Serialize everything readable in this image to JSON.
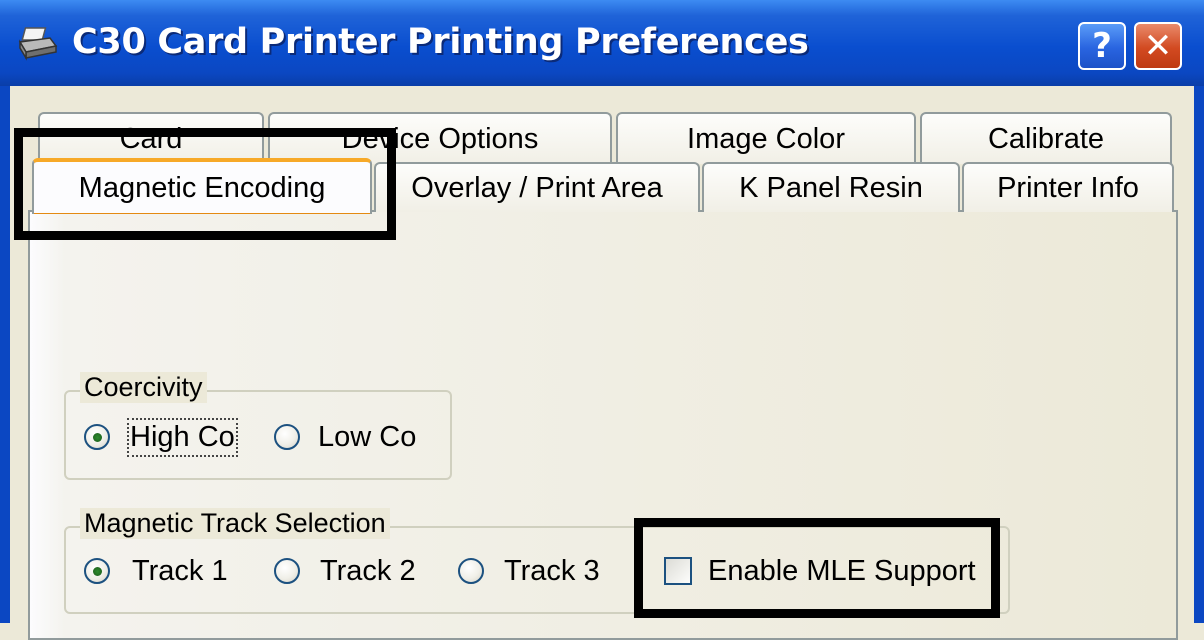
{
  "window": {
    "title": "C30 Card Printer Printing Preferences",
    "help_label": "?",
    "close_label": "✕"
  },
  "tabs_row1": [
    "Card",
    "Device Options",
    "Image Color",
    "Calibrate"
  ],
  "tabs_row2": [
    "Magnetic Encoding",
    "Overlay / Print Area",
    "K Panel Resin",
    "Printer Info"
  ],
  "active_tab": "Magnetic Encoding",
  "coercivity": {
    "label": "Coercivity",
    "options": [
      "High Co",
      "Low Co"
    ],
    "selected": "High Co"
  },
  "track_selection": {
    "label": "Magnetic Track Selection",
    "options": [
      "Track 1",
      "Track 2",
      "Track 3"
    ],
    "selected": "Track 1"
  },
  "mle": {
    "label": "Enable MLE Support",
    "checked": false
  }
}
